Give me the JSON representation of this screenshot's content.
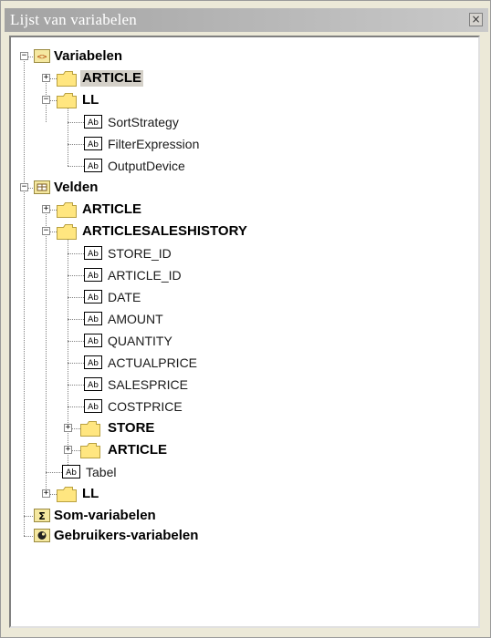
{
  "window": {
    "title": "Lijst van variabelen",
    "close_glyph": "×"
  },
  "tree": {
    "variabelen": {
      "label": "Variabelen",
      "article": "ARTICLE",
      "ll": {
        "label": "LL",
        "items": [
          "SortStrategy",
          "FilterExpression",
          "OutputDevice"
        ]
      }
    },
    "velden": {
      "label": "Velden",
      "article": "ARTICLE",
      "history": {
        "label": "ARTICLESALESHISTORY",
        "fields": [
          "STORE_ID",
          "ARTICLE_ID",
          "DATE",
          "AMOUNT",
          "QUANTITY",
          "ACTUALPRICE",
          "SALESPRICE",
          "COSTPRICE"
        ],
        "store": "STORE",
        "article": "ARTICLE"
      },
      "tabel": "Tabel",
      "ll": "LL"
    },
    "som": "Som-variabelen",
    "gebruikers": "Gebruikers-variabelen"
  },
  "icons": {
    "ab_label": "Ab",
    "toggle_plus": "+",
    "toggle_minus": "−",
    "sum_glyph": "Σ",
    "var_glyph": "<>"
  },
  "colors": {
    "folder": "#ffe680",
    "folder_edge": "#b8a040",
    "selection": "#d4d0c8"
  }
}
